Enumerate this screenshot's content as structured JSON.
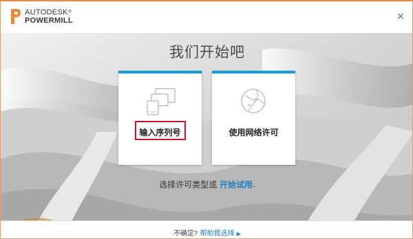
{
  "header": {
    "brand_line1": "AUTODESK",
    "brand_mark": "®",
    "brand_line2": "POWERMILL",
    "close_label": "×"
  },
  "main": {
    "title": "我们开始吧",
    "cards": [
      {
        "label": "输入序列号",
        "icon": "devices-icon",
        "highlighted": true
      },
      {
        "label": "使用网络许可",
        "icon": "network-globe-icon"
      }
    ],
    "choose_prefix": "选择许可类型或 ",
    "choose_link": "开始试用",
    "choose_suffix": "."
  },
  "footer": {
    "unsure_text": "不确定?",
    "help_link": "帮助我选择",
    "help_arrow": "▶"
  },
  "colors": {
    "accent": "#1a9ad6",
    "link": "#1a82c4",
    "highlight_border": "#d0142c",
    "logo_orange": "#e58a3a"
  }
}
